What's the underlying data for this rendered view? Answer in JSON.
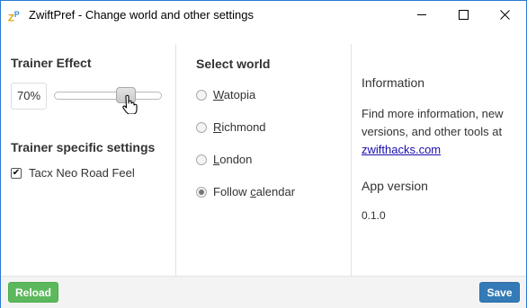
{
  "window": {
    "title": "ZwiftPref - Change world and other settings",
    "icon": "zwiftpref-app-icon"
  },
  "trainer": {
    "heading": "Trainer Effect",
    "effect_value": "70%",
    "slider_fraction": 0.7,
    "specific_heading": "Trainer specific settings",
    "checkbox_label": "Tacx Neo Road Feel",
    "checkbox_checked": true
  },
  "world": {
    "heading": "Select world",
    "options": [
      {
        "label": "Watopia",
        "selected": false
      },
      {
        "label": "Richmond",
        "selected": false
      },
      {
        "label": "London",
        "selected": false
      },
      {
        "label": "Follow calendar",
        "selected": true
      }
    ]
  },
  "info": {
    "heading": "Information",
    "text": "Find more information, new versions, and other tools at",
    "link": "zwifthacks.com",
    "version_heading": "App version",
    "version": "0.1.0"
  },
  "footer": {
    "reload_label": "Reload",
    "save_label": "Save"
  },
  "colors": {
    "reload": "#5cb85c",
    "save": "#337ab7",
    "link": "#1a0dab",
    "window_border": "#2b79d3"
  }
}
